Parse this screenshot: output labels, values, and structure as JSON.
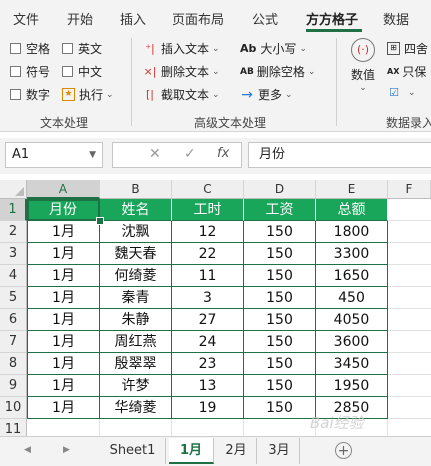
{
  "ribbon_tabs": [
    "文件",
    "开始",
    "插入",
    "页面布局",
    "公式",
    "方方格子",
    "数据"
  ],
  "text_processing": {
    "checkboxes": [
      "空格",
      "英文",
      "符号",
      "中文",
      "数字"
    ],
    "execute_label": "执行",
    "group_label": "文本处理"
  },
  "advanced_text": {
    "insert_text": "插入文本",
    "delete_text": "删除文本",
    "extract_text": "截取文本",
    "case_label": "大小写",
    "delete_space": "删除空格",
    "more": "更多",
    "case_icon_text": "Ab",
    "delete_space_icon_text": "AB",
    "group_label": "高级文本处理"
  },
  "numeric": {
    "value_label": "数值",
    "four_label": "四舍",
    "only_keep": "只保",
    "group_label": "数据录入"
  },
  "formula_bar": {
    "name_box": "A1",
    "cancel": "✕",
    "confirm": "✓",
    "fx": "fx",
    "content": "月份"
  },
  "columns": [
    "A",
    "B",
    "C",
    "D",
    "E",
    "F"
  ],
  "rows": [
    "1",
    "2",
    "3",
    "4",
    "5",
    "6",
    "7",
    "8",
    "9",
    "10",
    "11"
  ],
  "table": {
    "headers": [
      "月份",
      "姓名",
      "工时",
      "工资",
      "总额"
    ],
    "data": [
      [
        "1月",
        "沈飘",
        "12",
        "150",
        "1800"
      ],
      [
        "1月",
        "魏天春",
        "22",
        "150",
        "3300"
      ],
      [
        "1月",
        "何绮菱",
        "11",
        "150",
        "1650"
      ],
      [
        "1月",
        "秦青",
        "3",
        "150",
        "450"
      ],
      [
        "1月",
        "朱静",
        "27",
        "150",
        "4050"
      ],
      [
        "1月",
        "周红燕",
        "24",
        "150",
        "3600"
      ],
      [
        "1月",
        "殷翠翠",
        "23",
        "150",
        "3450"
      ],
      [
        "1月",
        "许梦",
        "13",
        "150",
        "1950"
      ],
      [
        "1月",
        "华绮菱",
        "19",
        "150",
        "2850"
      ]
    ]
  },
  "sheet_tabs": [
    "Sheet1",
    "1月",
    "2月",
    "3月"
  ],
  "active_sheet": "1月",
  "watermark": "Bai经验",
  "colors": {
    "accent": "#1e7145",
    "header_fill": "#1aa65a"
  }
}
